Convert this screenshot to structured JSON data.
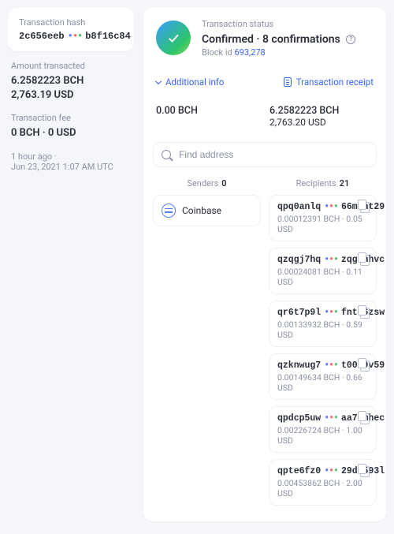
{
  "tx": {
    "hash_prefix": "2c656eeb",
    "hash_suffix": "b8f16c84",
    "amount_label": "Amount transacted",
    "amount_bch": "6.2582223 BCH",
    "amount_usd": "2,763.19 USD",
    "fee_label": "Transaction fee",
    "fee_bch": "0 BCH",
    "fee_usd": "0 USD",
    "age": "1 hour ago",
    "timestamp": "Jun 23, 2021 1:07 AM UTC",
    "hash_label": "Transaction hash"
  },
  "status": {
    "label": "Transaction status",
    "text": "Confirmed",
    "confirmations": "8 confirmations",
    "block_label": "Block id",
    "block_id": "693,278"
  },
  "actions": {
    "additional": "Additional info",
    "receipt": "Transaction receipt"
  },
  "totals": {
    "in_bch": "0.00 BCH",
    "out_bch": "6.2582223 BCH",
    "out_usd": "2,763.20 USD"
  },
  "search": {
    "placeholder": "Find address"
  },
  "senders": {
    "title": "Senders",
    "count": "0",
    "coinbase": "Coinbase"
  },
  "recipients": {
    "title": "Recipients",
    "count": "21",
    "items": [
      {
        "p": "qpq0anlq",
        "s": "66mtht29",
        "bch": "0.00012391 BCH",
        "usd": "0.05 USD"
      },
      {
        "p": "qzqgj7hq",
        "s": "zqg6hhvc",
        "bch": "0.00024081 BCH",
        "usd": "0.11 USD"
      },
      {
        "p": "qr6t7p9l",
        "s": "fnt36zsw",
        "bch": "0.00133932 BCH",
        "usd": "0.59 USD"
      },
      {
        "p": "qzknwug7",
        "s": "t0059v59",
        "bch": "0.00149634 BCH",
        "usd": "0.66 USD"
      },
      {
        "p": "qpdcp5uw",
        "s": "aa7umhec",
        "bch": "0.00226724 BCH",
        "usd": "1.00 USD"
      },
      {
        "p": "qpte6fz0",
        "s": "29de593l",
        "bch": "0.00453862 BCH",
        "usd": "2.00 USD"
      }
    ]
  }
}
